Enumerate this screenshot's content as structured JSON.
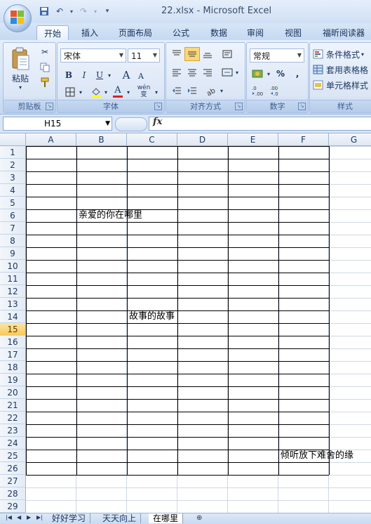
{
  "titlebar": {
    "title": "22.xlsx - Microsoft Excel"
  },
  "tabs": [
    "开始",
    "插入",
    "页面布局",
    "公式",
    "数据",
    "审阅",
    "视图",
    "福昕阅读器"
  ],
  "ribbon": {
    "clipboard": {
      "paste": "粘贴",
      "label": "剪贴板"
    },
    "font": {
      "name": "宋体",
      "size": "11",
      "bold": "B",
      "italic": "I",
      "underline": "U",
      "grow": "A",
      "shrink": "A",
      "color_a": "A",
      "wen": "wén\n变",
      "label": "字体"
    },
    "align": {
      "label": "对齐方式"
    },
    "number": {
      "format": "常规",
      "percent": "%",
      "comma": ",",
      "label": "数字"
    },
    "styles": {
      "conditional": "条件格式",
      "table": "套用表格格",
      "cell": "单元格样式",
      "label": "样式"
    }
  },
  "formula_bar": {
    "namebox": "H15",
    "fx": "fx",
    "value": ""
  },
  "columns": [
    "A",
    "B",
    "C",
    "D",
    "E",
    "F",
    "G"
  ],
  "rows": [
    "1",
    "2",
    "3",
    "4",
    "5",
    "6",
    "7",
    "8",
    "9",
    "10",
    "11",
    "12",
    "13",
    "14",
    "15",
    "16",
    "17",
    "18",
    "19",
    "20",
    "21",
    "22",
    "23",
    "24",
    "25",
    "26",
    "27",
    "28",
    "29"
  ],
  "cells": {
    "B6": "亲爱的你在哪里",
    "C14": "故事的故事",
    "F25": "倾听放下难舍的缘"
  },
  "sheet_tabs": [
    "好好学习",
    "天天向上",
    "在哪里"
  ],
  "active_sheet": "在哪里"
}
